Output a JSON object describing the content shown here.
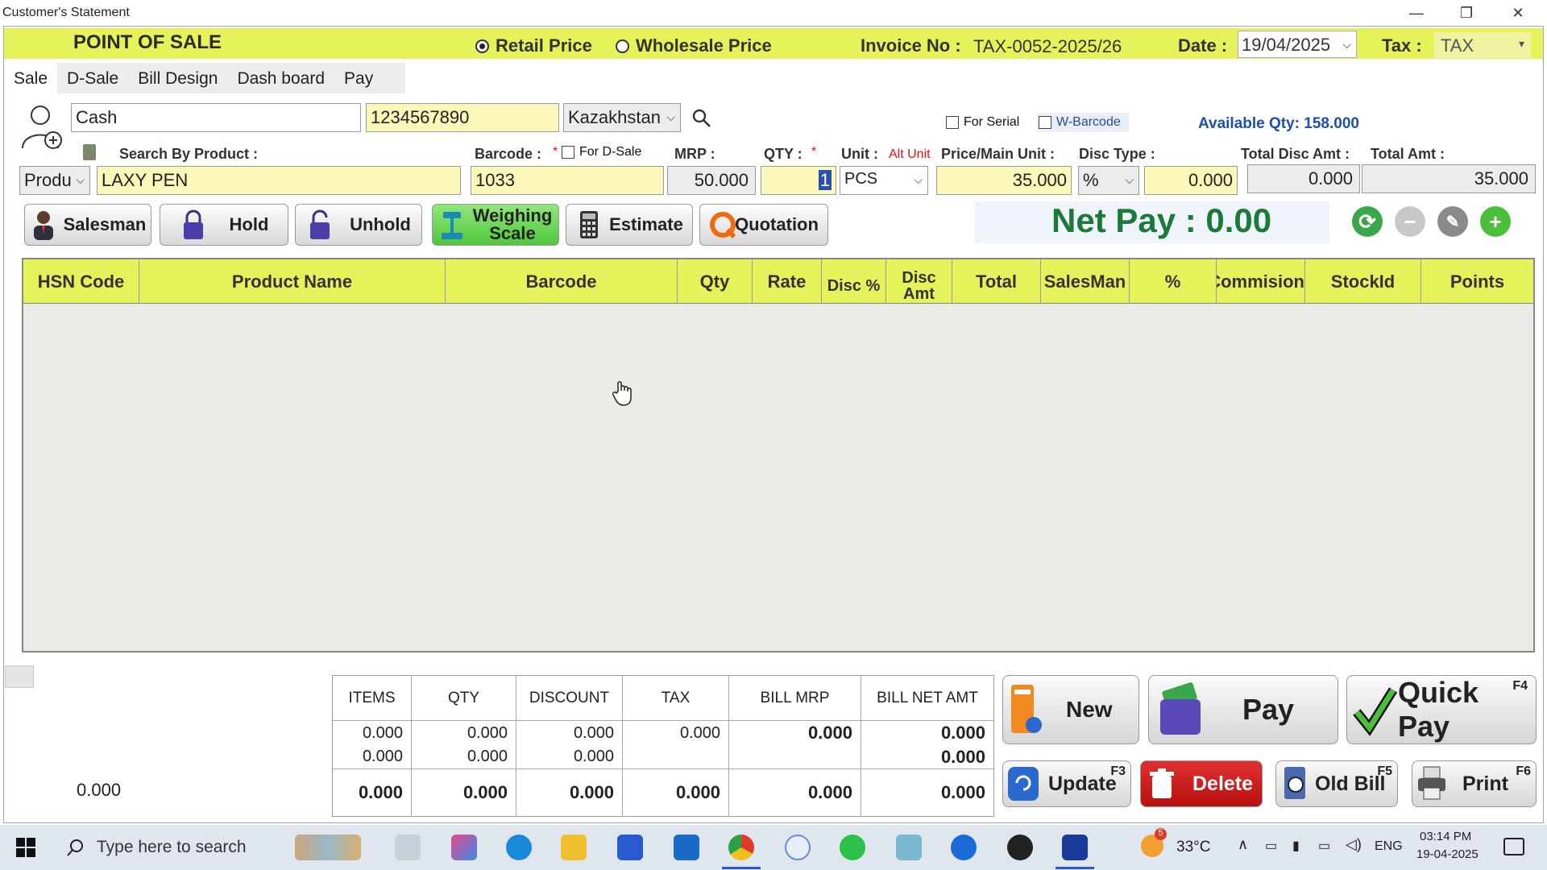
{
  "window": {
    "title": "Customer's Statement",
    "minimize": "—",
    "restore": "❐",
    "close": "✕"
  },
  "header": {
    "pos_title": "POINT OF SALE",
    "retail_label": "Retail Price",
    "wholesale_label": "Wholesale Price",
    "invoice_label": "Invoice No :",
    "invoice_value": "TAX-0052-2025/26",
    "date_label": "Date :",
    "date_value": "19/04/2025",
    "tax_label": "Tax :",
    "tax_value": "TAX",
    "selected_price": "Retail Price"
  },
  "tabs": [
    "Sale",
    "D-Sale",
    "Bill Design",
    "Dash board",
    "Pay"
  ],
  "customer": {
    "name": "Cash",
    "phone": "1234567890",
    "country": "Kazakhstan"
  },
  "options": {
    "for_serial": "For Serial",
    "w_barcode": "W-Barcode",
    "available_qty": "Available Qty: 158.000"
  },
  "labels": {
    "search_by_product": "Search By Product :",
    "barcode": "Barcode :",
    "for_dsale": "For D-Sale",
    "mrp": "MRP :",
    "qty": "QTY :",
    "unit": "Unit :",
    "alt_unit": "Alt Unit",
    "price_main_unit": "Price/Main Unit :",
    "disc_type": "Disc Type :",
    "total_disc_amt": "Total Disc Amt :",
    "total_amt": "Total Amt :",
    "star": "*"
  },
  "product": {
    "mode": "Produ",
    "name": "LAXY PEN",
    "barcode": "1033",
    "mrp": "50.000",
    "qty": "1",
    "unit": "PCS",
    "price": "35.000",
    "disc_type": "%",
    "disc_value": "0.000",
    "total_disc_amt": "0.000",
    "total_amt": "35.000"
  },
  "buttons": {
    "salesman": "Salesman",
    "hold": "Hold",
    "unhold": "Unhold",
    "weighing_scale": "Weighing Scale",
    "estimate": "Estimate",
    "quotation": "Quotation"
  },
  "net_pay": "Net Pay : 0.00",
  "grid_columns": [
    "HSN Code",
    "Product Name",
    "Barcode",
    "Qty",
    "Rate",
    "Disc %",
    "Disc Amt",
    "Total",
    "SalesMan",
    "%",
    "Commision",
    "StockId",
    "Points"
  ],
  "summary": {
    "left_value": "0.000",
    "headers": [
      "ITEMS",
      "QTY",
      "DISCOUNT",
      "TAX",
      "BILL MRP",
      "BILL NET AMT"
    ],
    "row1": [
      "0.000",
      "0.000",
      "0.000",
      "0.000",
      "0.000",
      "0.000"
    ],
    "row2": [
      "0.000",
      "0.000",
      "0.000",
      "",
      "",
      "0.000"
    ],
    "row3": [
      "0.000",
      "0.000",
      "0.000",
      "0.000",
      "0.000",
      "0.000"
    ]
  },
  "actions": {
    "new": "New",
    "pay": "Pay",
    "quick_pay": "Quick Pay",
    "quick_pay_key": "F4",
    "update": "Update",
    "update_key": "F3",
    "delete": "Delete",
    "old_bill": "Old Bill",
    "old_bill_key": "F5",
    "print": "Print",
    "print_key": "F6"
  },
  "taskbar": {
    "search_placeholder": "Type here to search",
    "weather": "33°C",
    "weather_badge": "5",
    "lang": "ENG",
    "time": "03:14 PM",
    "date": "19-04-2025"
  }
}
